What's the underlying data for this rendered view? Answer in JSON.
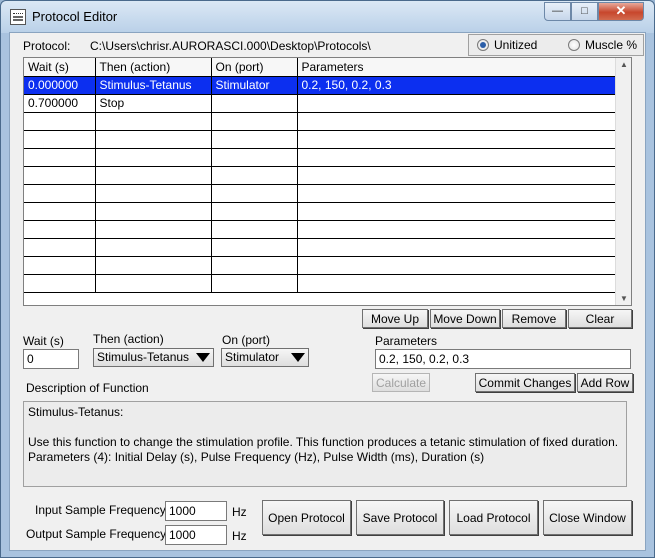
{
  "window": {
    "title": "Protocol Editor"
  },
  "protocol": {
    "label": "Protocol:",
    "path": "C:\\Users\\chrisr.AURORASCI.000\\Desktop\\Protocols\\",
    "units": [
      {
        "label": "Unitized",
        "selected": true
      },
      {
        "label": "Muscle %",
        "selected": false
      }
    ]
  },
  "table": {
    "columns": [
      "Wait (s)",
      "Then (action)",
      "On (port)",
      "Parameters"
    ],
    "rows": [
      [
        "0.000000",
        "Stimulus-Tetanus",
        "Stimulator",
        "0.2, 150, 0.2, 0.3"
      ],
      [
        "0.700000",
        "Stop",
        "",
        ""
      ],
      [
        "",
        "",
        "",
        ""
      ],
      [
        "",
        "",
        "",
        ""
      ],
      [
        "",
        "",
        "",
        ""
      ],
      [
        "",
        "",
        "",
        ""
      ],
      [
        "",
        "",
        "",
        ""
      ],
      [
        "",
        "",
        "",
        ""
      ],
      [
        "",
        "",
        "",
        ""
      ],
      [
        "",
        "",
        "",
        ""
      ],
      [
        "",
        "",
        "",
        ""
      ],
      [
        "",
        "",
        "",
        ""
      ]
    ],
    "selected_row": 0
  },
  "row_buttons": {
    "move_up": "Move Up",
    "move_down": "Move Down",
    "remove": "Remove",
    "clear": "Clear"
  },
  "editor": {
    "wait_label": "Wait (s)",
    "wait_value": "0",
    "action_label": "Then (action)",
    "action_value": "Stimulus-Tetanus",
    "port_label": "On (port)",
    "port_value": "Stimulator",
    "params_label": "Parameters",
    "params_value": "0.2, 150, 0.2, 0.3",
    "calculate": "Calculate",
    "commit": "Commit Changes",
    "add_row": "Add Row"
  },
  "description": {
    "label": "Description of Function",
    "title": "Stimulus-Tetanus:",
    "body": "Use this function to change the stimulation profile.  This function produces a tetanic stimulation of fixed duration.",
    "params": "Parameters (4): Initial Delay (s), Pulse Frequency (Hz), Pulse Width (ms), Duration (s)"
  },
  "sampling": {
    "input_label": "Input Sample Frequency",
    "input_value": "1000",
    "output_label": "Output Sample Frequency",
    "output_value": "1000",
    "unit": "Hz"
  },
  "bottom_buttons": {
    "open": "Open Protocol",
    "save": "Save Protocol",
    "load": "Load Protocol",
    "close": "Close Window"
  }
}
